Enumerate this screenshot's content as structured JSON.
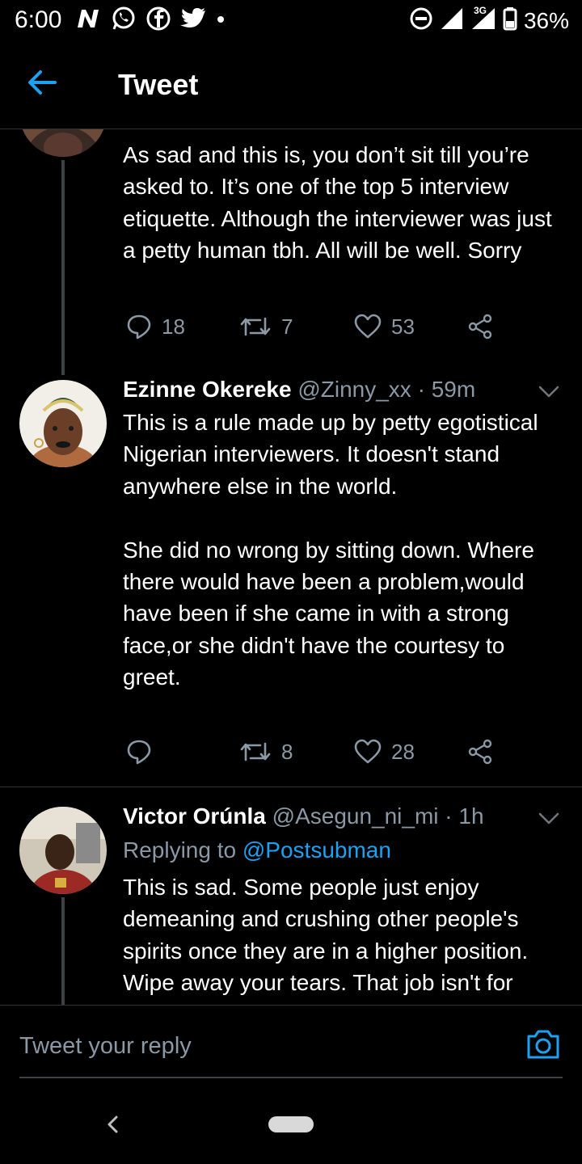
{
  "status_bar": {
    "time": "6:00",
    "battery": "36%",
    "network": "3G",
    "left_icons": [
      "n-app-icon",
      "whatsapp-icon",
      "facebook-icon",
      "twitter-icon",
      "dot-icon"
    ],
    "right_icons": [
      "do-not-disturb-icon",
      "signal-icon",
      "signal-3g-icon",
      "battery-icon"
    ]
  },
  "header": {
    "title": "Tweet",
    "accent": "#1da1f2"
  },
  "tweets": [
    {
      "text": "As sad and this is, you don’t sit till you’re asked to. It’s one of the top 5 interview etiquette. Although the interviewer was just a petty human tbh. All will be well. Sorry",
      "replies": "18",
      "retweets": "7",
      "likes": "53"
    },
    {
      "name": "Ezinne Okereke",
      "handle": "@Zinny_xx",
      "time": "· 59m",
      "text": "This is a rule made up by petty egotistical Nigerian interviewers. It doesn't stand anywhere else in the world.\n\nShe did no wrong by sitting down. Where there would have been a problem,would have been if she came in with a strong face,or she didn't have the courtesy to greet.",
      "replies": "",
      "retweets": "8",
      "likes": "28"
    },
    {
      "name": "Victor Orúnla",
      "handle": "@Asegun_ni_mi",
      "time": "· 1h",
      "replying_prefix": "Replying to ",
      "replying_to": "@Postsubman",
      "text": "This is sad. Some people just enjoy demeaning and crushing other people's spirits once they are in a higher position. Wipe away your tears. That job isn't for"
    }
  ],
  "composer": {
    "placeholder": "Tweet your reply"
  },
  "colors": {
    "background": "#000000",
    "secondary_text": "#8b98a5",
    "divider": "#2f3336",
    "link": "#1da1f2"
  }
}
